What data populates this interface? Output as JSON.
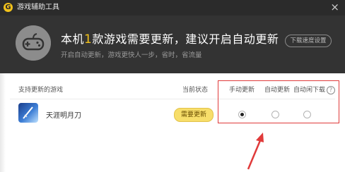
{
  "window": {
    "title": "游戏辅助工具",
    "logo_letter": "G"
  },
  "hero": {
    "headline_prefix": "本机",
    "count": "1",
    "headline_suffix": "款游戏需要更新，建议开启自动更新",
    "subtext": "开启自动更新，游戏更快人一步，省时，省流量",
    "speed_button": "下载速度设置"
  },
  "table": {
    "headers": {
      "game": "支持更新的游戏",
      "status": "当前状态",
      "manual": "手动更新",
      "auto": "自动更新",
      "auto_idle": "自动闲下载",
      "help": "?"
    },
    "rows": [
      {
        "name": "天涯明月刀",
        "status_button": "需要更新",
        "selected_mode": "manual"
      }
    ]
  },
  "colors": {
    "accent": "#f2c21b",
    "annotation": "#e03a3a",
    "header_bg": "#333333"
  }
}
